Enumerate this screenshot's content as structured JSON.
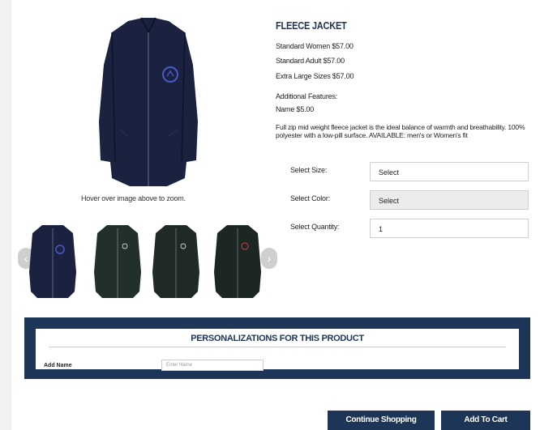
{
  "product": {
    "title": "FLEECE JACKET",
    "prices": [
      "Standard Women $57.00",
      "Standard Adult $57.00",
      "Extra Large Sizes $57.00"
    ],
    "additional_heading": "Additional Features:",
    "additional_items": [
      "Name $5.00"
    ],
    "description": "Full zip mid weight fleece jacket is the ideal balance of warmth and breathability. 100% polyester with a low-pill surface. AVAILABLE: men's or Women's fit"
  },
  "image": {
    "zoom_hint": "Hover over image above to zoom."
  },
  "options": {
    "size_label": "Select Size:",
    "size_value": "Select",
    "color_label": "Select Color:",
    "color_value": "Select",
    "quantity_label": "Select Quantity:",
    "quantity_value": "1"
  },
  "personalization": {
    "heading": "PERSONALIZATIONS FOR THIS PRODUCT",
    "field_label": "Add Name",
    "field_placeholder": "Enter Name"
  },
  "buttons": {
    "continue": "Continue Shopping",
    "add_to_cart": "Add To Cart"
  },
  "thumbnails": [
    {
      "color": "navy",
      "hex": "#1a2240"
    },
    {
      "color": "dark green",
      "hex": "#22302a"
    },
    {
      "color": "dark green",
      "hex": "#1f2a25"
    },
    {
      "color": "dark green",
      "hex": "#1c2622"
    }
  ],
  "colors": {
    "brand": "#1d3557",
    "jacket_navy": "#1a2240",
    "logo": "#4a58c8"
  }
}
